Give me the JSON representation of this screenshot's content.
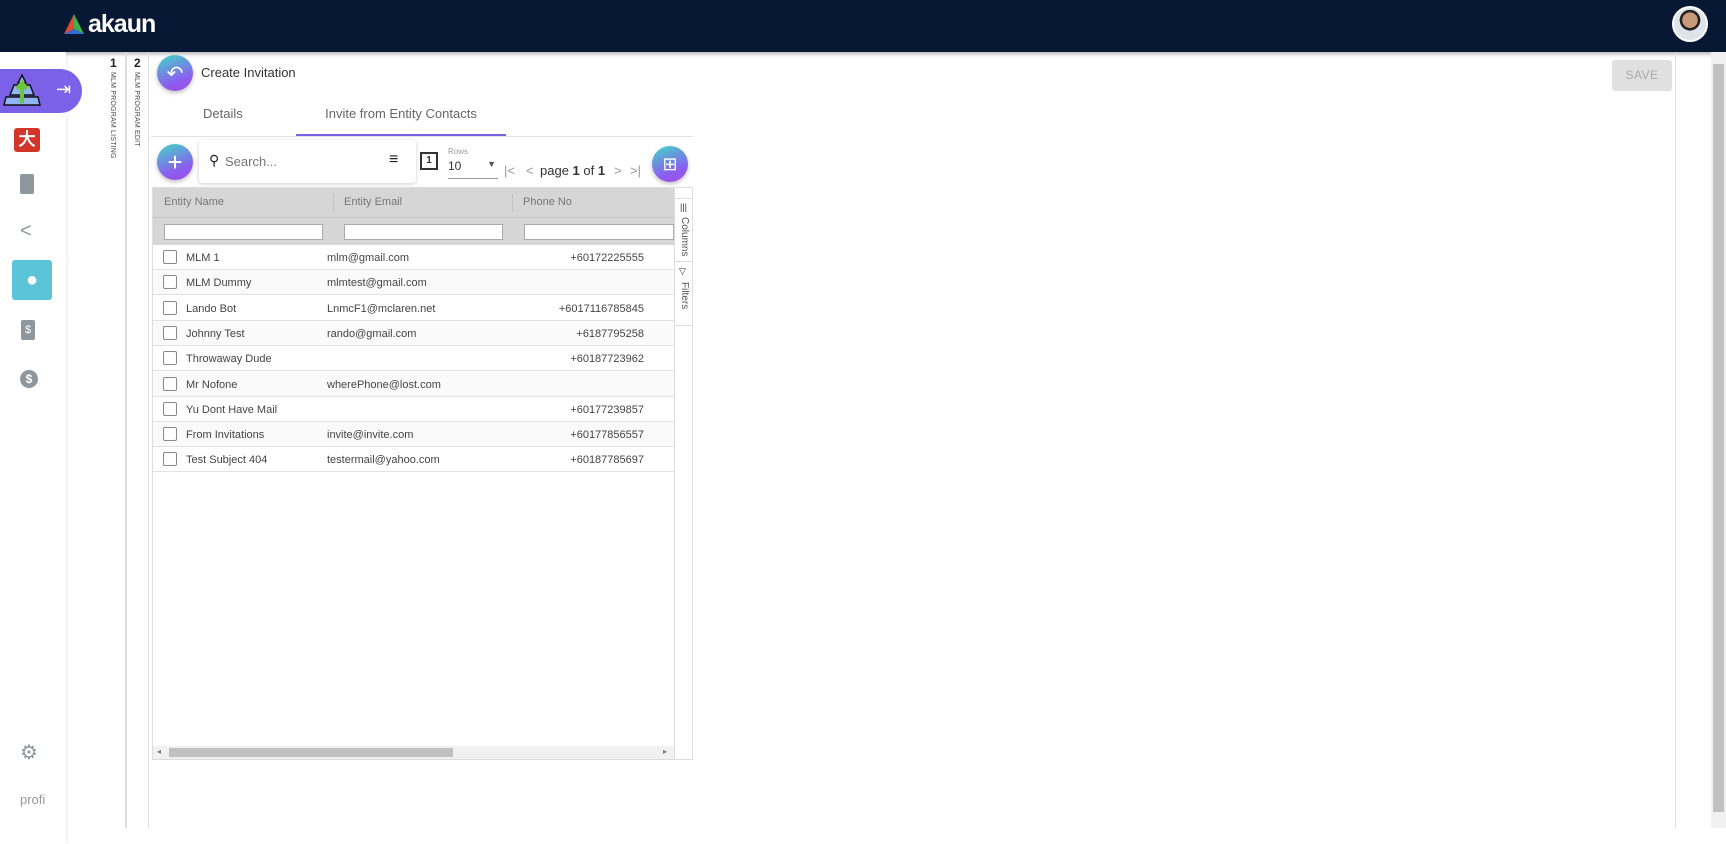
{
  "app": {
    "brand": "akaun"
  },
  "breadcrumbs": [
    {
      "num": "1",
      "label": "MLM PROGRAM LISTING"
    },
    {
      "num": "2",
      "label": "MLM PROGRAM EDIT"
    }
  ],
  "page": {
    "title": "Create Invitation",
    "save_label": "SAVE"
  },
  "tabs": [
    {
      "label": "Details"
    },
    {
      "label": "Invite from Entity Contacts",
      "active": true
    }
  ],
  "toolbar": {
    "search_placeholder": "Search...",
    "rows_label": "Rows",
    "rows_value": "10",
    "page_label": "page",
    "page_current": "1",
    "page_of": "of",
    "page_total": "1"
  },
  "grid": {
    "columns": [
      "Entity Name",
      "Entity Email",
      "Phone No"
    ],
    "side_tabs": [
      "Columns",
      "Filters"
    ],
    "rows": [
      {
        "name": "MLM 1",
        "email": "mlm@gmail.com",
        "phone": "+60172225555"
      },
      {
        "name": "MLM Dummy",
        "email": "mlmtest@gmail.com",
        "phone": ""
      },
      {
        "name": "Lando Bot",
        "email": "LnmcF1@mclaren.net",
        "phone": "+6017116785845"
      },
      {
        "name": "Johnny Test",
        "email": "rando@gmail.com",
        "phone": "+6187795258"
      },
      {
        "name": "Throwaway Dude",
        "email": "",
        "phone": "+60187723962"
      },
      {
        "name": "Mr Nofone",
        "email": "wherePhone@lost.com",
        "phone": ""
      },
      {
        "name": "Yu Dont Have Mail",
        "email": "",
        "phone": "+60177239857"
      },
      {
        "name": "From Invitations",
        "email": "invite@invite.com",
        "phone": "+60177856557"
      },
      {
        "name": "Test Subject 404",
        "email": "testermail@yahoo.com",
        "phone": "+60187785697"
      }
    ]
  },
  "sidebar": {
    "profile_alt": "profi"
  },
  "colors": {
    "topbar": "#061833",
    "accent": "#7b61e8",
    "active_item": "#5bc4d8"
  }
}
